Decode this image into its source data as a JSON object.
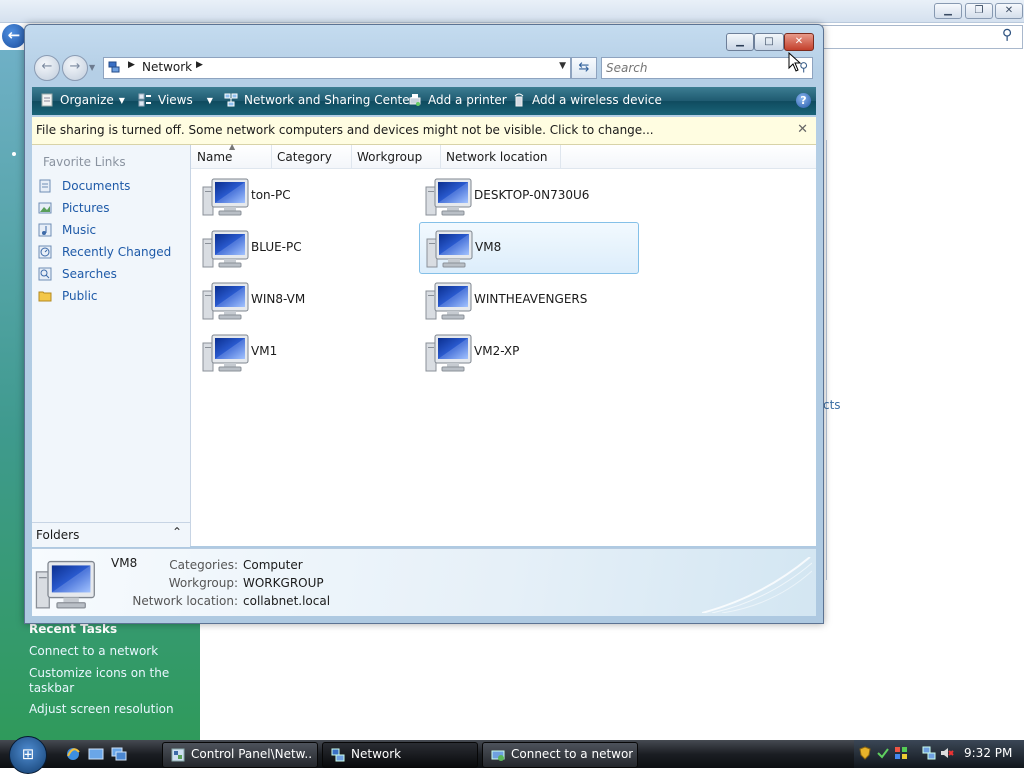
{
  "background_window": {
    "recent_tasks_title": "Recent Tasks",
    "tasks": [
      "Connect to a network",
      "Customize icons on the taskbar",
      "Adjust screen resolution"
    ],
    "cutoff_text": "cts"
  },
  "window": {
    "address": {
      "label": "Network"
    },
    "search": {
      "placeholder": "Search"
    },
    "toolbar": {
      "organize": "Organize",
      "views": "Views",
      "network_sharing": "Network and Sharing Center",
      "add_printer": "Add a printer",
      "add_wireless": "Add a wireless device"
    },
    "infobar": {
      "message": "File sharing is turned off. Some network computers and devices might not be visible. Click to change..."
    },
    "favorite_links": {
      "title": "Favorite Links",
      "items": [
        {
          "label": "Documents",
          "icon": "documents-icon"
        },
        {
          "label": "Pictures",
          "icon": "pictures-icon"
        },
        {
          "label": "Music",
          "icon": "music-icon"
        },
        {
          "label": "Recently Changed",
          "icon": "recently-changed-icon"
        },
        {
          "label": "Searches",
          "icon": "searches-icon"
        },
        {
          "label": "Public",
          "icon": "folder-icon"
        }
      ]
    },
    "folders_label": "Folders",
    "columns": [
      "Name",
      "Category",
      "Workgroup",
      "Network location"
    ],
    "items": [
      {
        "name": "ton-PC",
        "selected": false
      },
      {
        "name": "DESKTOP-0N730U6",
        "selected": false
      },
      {
        "name": "BLUE-PC",
        "selected": false
      },
      {
        "name": "VM8",
        "selected": true
      },
      {
        "name": "WIN8-VM",
        "selected": false
      },
      {
        "name": "WINTHEAVENGERS",
        "selected": false
      },
      {
        "name": "VM1",
        "selected": false
      },
      {
        "name": "VM2-XP",
        "selected": false
      }
    ],
    "details": {
      "name": "VM8",
      "categories_label": "Categories:",
      "categories": "Computer",
      "workgroup_label": "Workgroup:",
      "workgroup": "WORKGROUP",
      "location_label": "Network location:",
      "location": "collabnet.local"
    }
  },
  "taskbar": {
    "tasks": [
      {
        "label": "Control Panel\\Netw...",
        "active": false
      },
      {
        "label": "Network",
        "active": true
      },
      {
        "label": "Connect to a network",
        "active": false
      }
    ],
    "clock": "9:32 PM"
  },
  "colors": {
    "toolbar": "#1f5a70",
    "infobar": "#fffde1",
    "selection": "#dcedfb",
    "link": "#1e5aa8",
    "close_button": "#c3402c"
  }
}
